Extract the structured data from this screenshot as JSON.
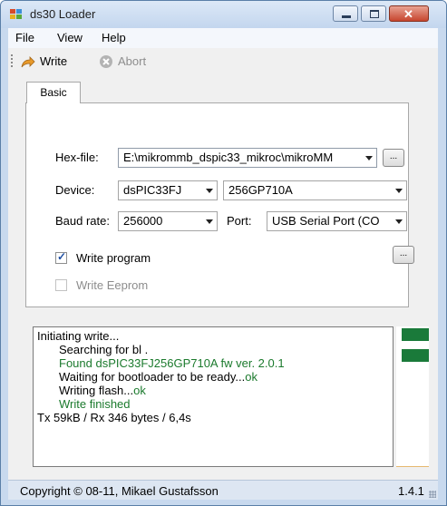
{
  "window": {
    "title": "ds30 Loader"
  },
  "menu": {
    "items": [
      "File",
      "View",
      "Help"
    ]
  },
  "toolbar": {
    "write_label": "Write",
    "abort_label": "Abort"
  },
  "tabs": {
    "basic": "Basic"
  },
  "form": {
    "hex_label": "Hex-file:",
    "hex_value": "E:\\mikrommb_dspic33_mikroc\\mikroMM",
    "device_label": "Device:",
    "device_family": "dsPIC33FJ",
    "device_model": "256GP710A",
    "baud_label": "Baud rate:",
    "baud_value": "256000",
    "port_label": "Port:",
    "port_value": "USB Serial Port (CO",
    "browse_label": "...",
    "write_program_label": "Write program",
    "write_program_checked": true,
    "write_eeprom_label": "Write Eeprom",
    "write_eeprom_checked": false
  },
  "log": {
    "lines": [
      "Initiating write...",
      "Searching for bl .",
      "Found dsPIC33FJ256GP710A fw ver. 2.0.1",
      "Waiting for bootloader to be ready...",
      "ok",
      "Writing flash...",
      "ok",
      "Write finished",
      "Tx 59kB / Rx 346 bytes / 6,4s"
    ]
  },
  "status": {
    "copyright": "Copyright © 08-11, Mikael Gustafsson",
    "version": "1.4.1"
  },
  "colors": {
    "log_green": "#1b7a2d",
    "progress_green": "#1a7a3a"
  }
}
